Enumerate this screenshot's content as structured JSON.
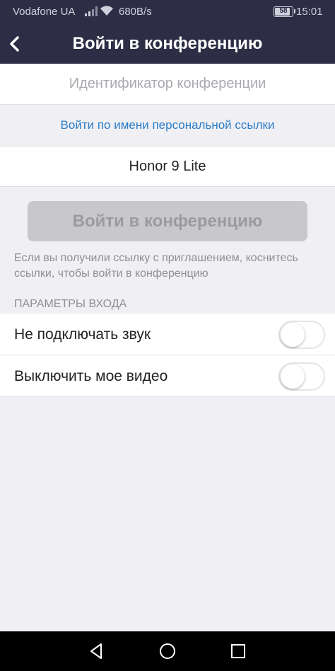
{
  "status_bar": {
    "carrier": "Vodafone UA",
    "speed": "680B/s",
    "battery": "58",
    "time": "15:01"
  },
  "app_bar": {
    "title": "Войти в конференцию"
  },
  "form": {
    "meeting_id_placeholder": "Идентификатор конференции",
    "personal_link_label": "Войти по имени персональной ссылки",
    "name_value": "Honor 9 Lite",
    "join_button": "Войти в конференцию",
    "hint": "Если вы получили ссылку с приглашением, коснитесь ссылки, чтобы войти в конференцию"
  },
  "options": {
    "header": "ПАРАМЕТРЫ ВХОДА",
    "items": [
      {
        "label": "Не подключать звук",
        "enabled": false
      },
      {
        "label": "Выключить мое видео",
        "enabled": false
      }
    ]
  },
  "colors": {
    "app_bar_bg": "#2d2d45",
    "link": "#2d7ec7",
    "disabled_button": "#c8c8cc"
  }
}
